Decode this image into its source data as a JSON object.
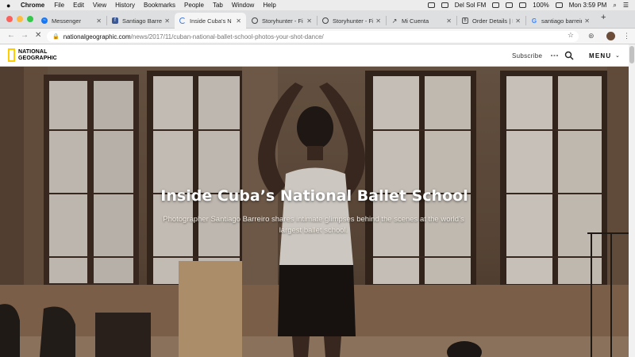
{
  "os_menubar": {
    "app": "Chrome",
    "menus": [
      "File",
      "Edit",
      "View",
      "History",
      "Bookmarks",
      "People",
      "Tab",
      "Window",
      "Help"
    ],
    "station": "Del Sol FM",
    "battery": "100%",
    "clock": "Mon 3:59 PM"
  },
  "browser": {
    "tabs": [
      {
        "label": "Messenger",
        "icon": "messenger-icon"
      },
      {
        "label": "Santiago Barreir",
        "icon": "facebook-icon"
      },
      {
        "label": "Inside Cuba's N",
        "icon": "loading-icon",
        "active": true
      },
      {
        "label": "Storyhunter - Fi",
        "icon": "storyhunter-icon"
      },
      {
        "label": "Storyhunter - Fi",
        "icon": "storyhunter-icon"
      },
      {
        "label": "Mi Cuenta",
        "icon": "link-icon"
      },
      {
        "label": "Order Details | B",
        "icon": "bh-icon"
      },
      {
        "label": "santiago barreir",
        "icon": "google-icon"
      }
    ],
    "address": {
      "host": "nationalgeographic.com",
      "path": "/news/2017/11/cuban-national-ballet-school-photos-your-shot-dance/"
    }
  },
  "site_header": {
    "logo_line1": "NATIONAL",
    "logo_line2": "GEOGRAPHIC",
    "subscribe": "Subscribe",
    "menu": "MENU"
  },
  "hero": {
    "title": "Inside Cuba’s National Ballet School",
    "subtitle": "Photographer Santiago Barreiro shares intimate glimpses behind the scenes at the world’s largest ballet school."
  },
  "colors": {
    "ng_yellow": "#ffce00",
    "facebook_blue": "#3b5998",
    "close_red": "#fc605c",
    "minimize_yellow": "#fdbc40",
    "zoom_green": "#34c84a"
  }
}
